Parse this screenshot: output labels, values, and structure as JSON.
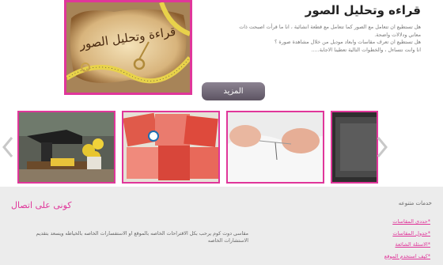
{
  "featured": {
    "title": "قراءه وتحليل الصور",
    "paragraphs": [
      "هل تستطيع ان تتعامل مع الصور كما تتعامل مع قطعة انشائية ، انا ما قرأت اصبحت ذات",
      "معاني ودلالات واضحة.",
      "هل تستطيع ان تعرف مقاسات وابعاد موديل من خلال مشاهدة صورة ؟",
      "انا وانت نتساءل ، والخطوات التالية تعطينا الاجابة....."
    ],
    "image_caption": "قراءة وتحليل الصور",
    "more_label": "المزيد"
  },
  "carousel": {
    "prev_icon": "chevron-left-icon",
    "next_icon": "chevron-right-icon",
    "items": [
      {
        "name": "sewing-machine-photo"
      },
      {
        "name": "fabric-swatches-photo"
      },
      {
        "name": "hand-sewing-photo"
      },
      {
        "name": "fabric-texture-photo"
      }
    ]
  },
  "footer": {
    "contact": {
      "title": "كونى على اتصال",
      "text": "مقاسى دوت كوم يرحب بكل الاقتراحات الخاصه بالموقع او الاستفسارات الخاصه بالخياطه ويسعد بتقديم الاستشارات الخاصه"
    },
    "services": {
      "title": "خدمات متنوعه",
      "links": [
        "*حددى المقاسات",
        "*جدول المقاسات",
        "*الاسئلة الشائعة",
        "*كيف استخدم الموقع"
      ]
    }
  },
  "colors": {
    "accent": "#e0369a",
    "button": "#6e6573",
    "footer_bg": "#ececec"
  }
}
